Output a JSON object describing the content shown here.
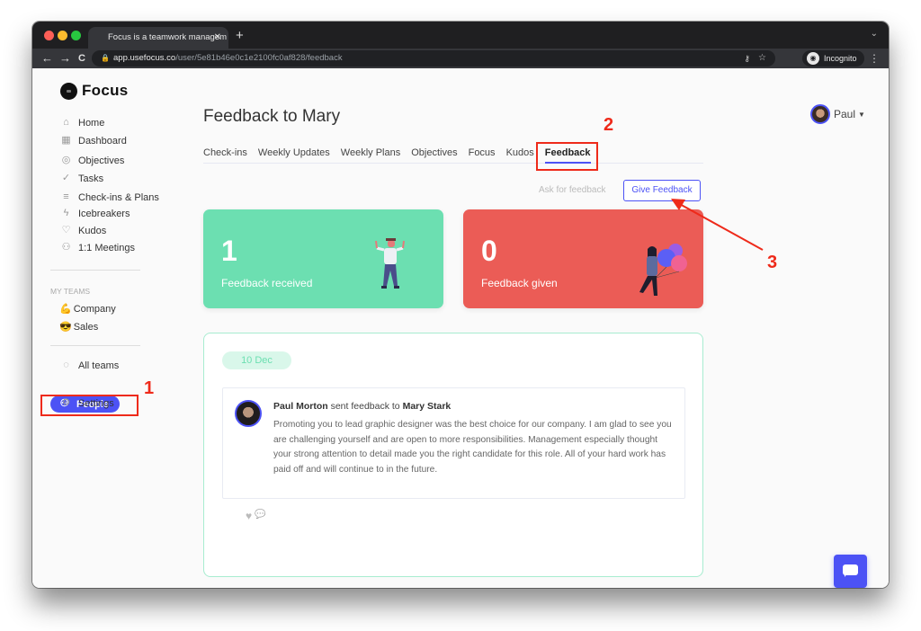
{
  "browser": {
    "tab_title": "Focus is a teamwork managem",
    "tab_close": "✕",
    "new_tab": "+",
    "url_host": "app.usefocus.co",
    "url_path": "/user/5e81b46e0c1e2100fc0af828/feedback",
    "incognito_label": "Incognito",
    "back": "←",
    "forward": "→",
    "reload": "C"
  },
  "app": {
    "logo_text": "Focus",
    "sidebar": {
      "items": [
        {
          "label": "Home",
          "icon": "home-icon",
          "glyph": "⌂"
        },
        {
          "label": "Dashboard",
          "icon": "dashboard-icon",
          "glyph": "▦"
        },
        {
          "label": "Objectives",
          "icon": "target-icon",
          "glyph": "◎"
        },
        {
          "label": "Tasks",
          "icon": "check-circle-icon",
          "glyph": "✓"
        },
        {
          "label": "Check-ins & Plans",
          "icon": "checkins-icon",
          "glyph": "≡"
        },
        {
          "label": "Icebreakers",
          "icon": "lightning-icon",
          "glyph": "ϟ"
        },
        {
          "label": "Kudos",
          "icon": "heart-badge-icon",
          "glyph": "♡"
        },
        {
          "label": "1:1 Meetings",
          "icon": "people-pair-icon",
          "glyph": "⚇"
        }
      ],
      "teams_label": "MY TEAMS",
      "teams": [
        {
          "label": "Company",
          "emoji": "💪"
        },
        {
          "label": "Sales",
          "emoji": "😎"
        }
      ],
      "bottom": [
        {
          "label": "All teams",
          "glyph": "◌"
        },
        {
          "label": "People",
          "glyph": "⚇",
          "active": true
        },
        {
          "label": "Settings",
          "glyph": "⚙"
        }
      ]
    },
    "header": {
      "title": "Feedback to Mary",
      "user_name": "Paul",
      "caret": "▼"
    },
    "tabs": [
      "Check-ins",
      "Weekly Updates",
      "Weekly Plans",
      "Objectives",
      "Focus",
      "Kudos",
      "Feedback"
    ],
    "active_tab": "Feedback",
    "actions": {
      "ask_label": "Ask for feedback",
      "give_label": "Give Feedback"
    },
    "stats": [
      {
        "value": "1",
        "label": "Feedback received",
        "color": "#6cdfb1"
      },
      {
        "value": "0",
        "label": "Feedback given",
        "color": "#eb5c56"
      }
    ],
    "feed": {
      "date": "10 Dec",
      "entry": {
        "sender": "Paul Morton",
        "verb": "sent feedback to",
        "recipient": "Mary Stark",
        "body": "Promoting you to lead graphic designer was the best choice for our company. I am glad to see you are challenging yourself and are open to more responsibilities. Management especially thought your strong attention to detail made you the right candidate for this role. All of your hard work has paid off and will continue to in the future."
      },
      "reactions": {
        "like": "♥",
        "comment": "💬"
      }
    }
  },
  "annotations": {
    "one": "1",
    "two": "2",
    "three": "3"
  },
  "colors": {
    "accent": "#4c52f5",
    "green": "#6cdfb1",
    "red": "#eb5c56",
    "annotation": "#ee2a1a"
  }
}
